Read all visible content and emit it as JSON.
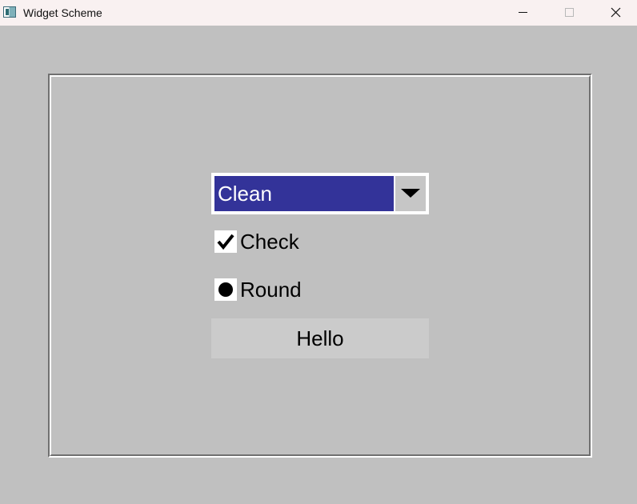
{
  "window": {
    "title": "Widget Scheme"
  },
  "titlebar_icons": {
    "app": "app-window-icon",
    "minimize": "minimize-icon",
    "maximize": "maximize-icon",
    "close": "close-icon"
  },
  "choice": {
    "selected": "Clean",
    "arrow_icon": "dropdown-arrow-icon"
  },
  "check_button": {
    "label": "Check",
    "checked": true
  },
  "round_button": {
    "label": "Round",
    "selected": true
  },
  "button": {
    "label": "Hello"
  },
  "colors": {
    "window_bg": "#c0c0c0",
    "titlebar_bg": "#f9f1f1",
    "selection_bg": "#333399",
    "button_bg": "#cbcbcb"
  }
}
